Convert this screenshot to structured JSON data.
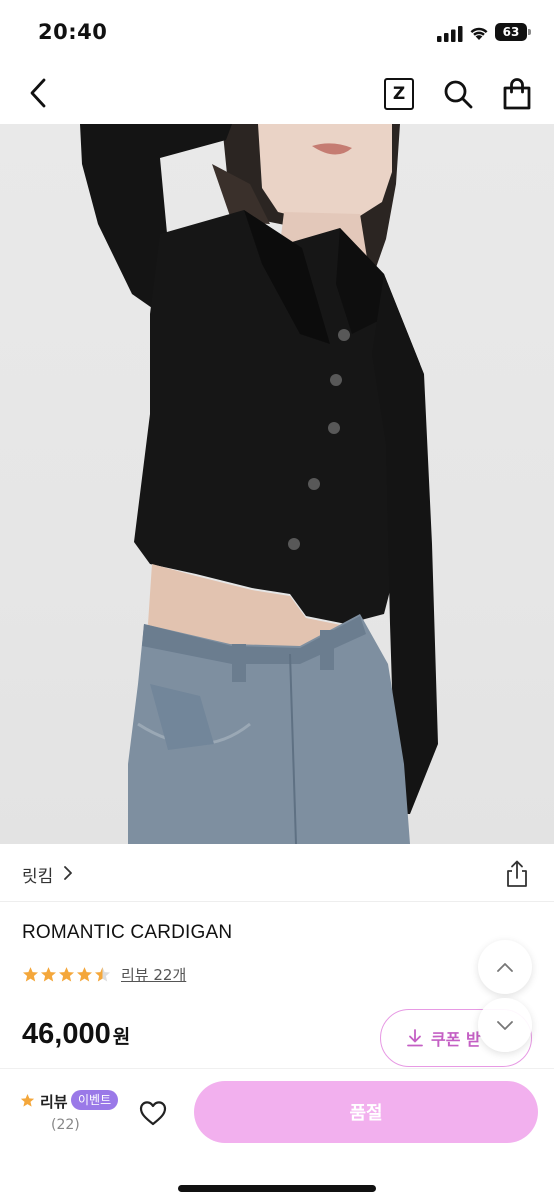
{
  "status_bar": {
    "time": "20:40",
    "battery": "63",
    "icons": [
      "signal-icon",
      "wifi-icon",
      "battery-icon"
    ]
  },
  "nav": {
    "back_icon": "chevron-left-icon",
    "zigzag_label": "Z",
    "search_icon": "search-icon",
    "bag_icon": "shopping-bag-icon"
  },
  "product": {
    "image_icon": "product-photo",
    "brand": "릿킴",
    "title": "ROMANTIC CARDIGAN",
    "rating": 4.5,
    "rating_max": 5,
    "review_link": "리뷰 22개",
    "price": "46,000",
    "price_unit": "원",
    "coupon_label": "쿠폰 받",
    "share_icon": "share-icon"
  },
  "bottom_bar": {
    "review_label": "리뷰",
    "event_badge": "이벤트",
    "review_count": "(22)",
    "like_icon": "heart-icon",
    "soldout_label": "품절"
  },
  "colors": {
    "accent_pink": "#f2b0ee",
    "coupon_border": "#e79ae4",
    "coupon_text": "#c45fc4",
    "star": "#f4a73b",
    "event_badge": "#9a79e8"
  }
}
